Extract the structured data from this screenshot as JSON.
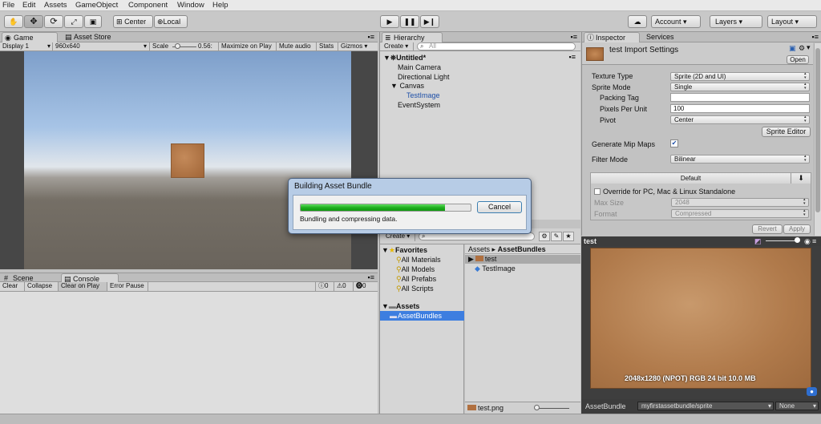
{
  "menu": [
    "File",
    "Edit",
    "Assets",
    "GameObject",
    "Component",
    "Window",
    "Help"
  ],
  "toolbar": {
    "center_label": "Center",
    "local_label": "Local",
    "account_label": "Account",
    "layers_label": "Layers",
    "layout_label": "Layout"
  },
  "game": {
    "tab_game": "Game",
    "tab_asset_store": "Asset Store",
    "display": "Display 1",
    "resolution": "960x640",
    "scale_label": "Scale",
    "scale_value": "0.56:",
    "scale_fraction": 0.2,
    "maximize": "Maximize on Play",
    "mute": "Mute audio",
    "stats": "Stats",
    "gizmos": "Gizmos"
  },
  "console": {
    "tab_scene": "Scene",
    "tab_console": "Console",
    "clear": "Clear",
    "collapse": "Collapse",
    "clear_on_play": "Clear on Play",
    "error_pause": "Error Pause",
    "count_log": "0",
    "count_warn": "0",
    "count_error": "0"
  },
  "hierarchy": {
    "tab": "Hierarchy",
    "create": "Create",
    "search_placeholder": "All",
    "scene": "Untitled*",
    "items": [
      "Main Camera",
      "Directional Light",
      "Canvas",
      "TestImage",
      "EventSystem"
    ]
  },
  "project": {
    "create": "Create",
    "favorites": "Favorites",
    "fav_items": [
      "All Materials",
      "All Models",
      "All Prefabs",
      "All Scripts"
    ],
    "assets": "Assets",
    "asset_bundles": "AssetBundles",
    "breadcrumb_root": "Assets",
    "breadcrumb_sep": "▸",
    "breadcrumb_current": "AssetBundles",
    "files": [
      "test",
      "TestImage"
    ],
    "footer_file": "test.png"
  },
  "inspector": {
    "tab_inspector": "Inspector",
    "tab_services": "Services",
    "title": "test Import Settings",
    "open": "Open",
    "texture_type_label": "Texture Type",
    "texture_type": "Sprite (2D and UI)",
    "sprite_mode_label": "Sprite Mode",
    "sprite_mode": "Single",
    "packing_tag_label": "Packing Tag",
    "packing_tag": "",
    "ppu_label": "Pixels Per Unit",
    "ppu": "100",
    "pivot_label": "Pivot",
    "pivot": "Center",
    "sprite_editor": "Sprite Editor",
    "mipmaps_label": "Generate Mip Maps",
    "mipmaps_check": "✔",
    "filter_label": "Filter Mode",
    "filter": "Bilinear",
    "default_tab": "Default",
    "override_label": "Override for PC, Mac & Linux Standalone",
    "max_size_label": "Max Size",
    "max_size": "2048",
    "format_label": "Format",
    "format": "Compressed",
    "revert": "Revert",
    "apply": "Apply"
  },
  "preview": {
    "name": "test",
    "info": "2048x1280 (NPOT)  RGB 24 bit   10.0 MB",
    "assetbundle_label": "AssetBundle",
    "bundle_name": "myfirstassetbundle/sprite",
    "variant": "None"
  },
  "dialog": {
    "title": "Building Asset Bundle",
    "cancel": "Cancel",
    "message": "Bundling and compressing data.",
    "progress": 0.85
  }
}
